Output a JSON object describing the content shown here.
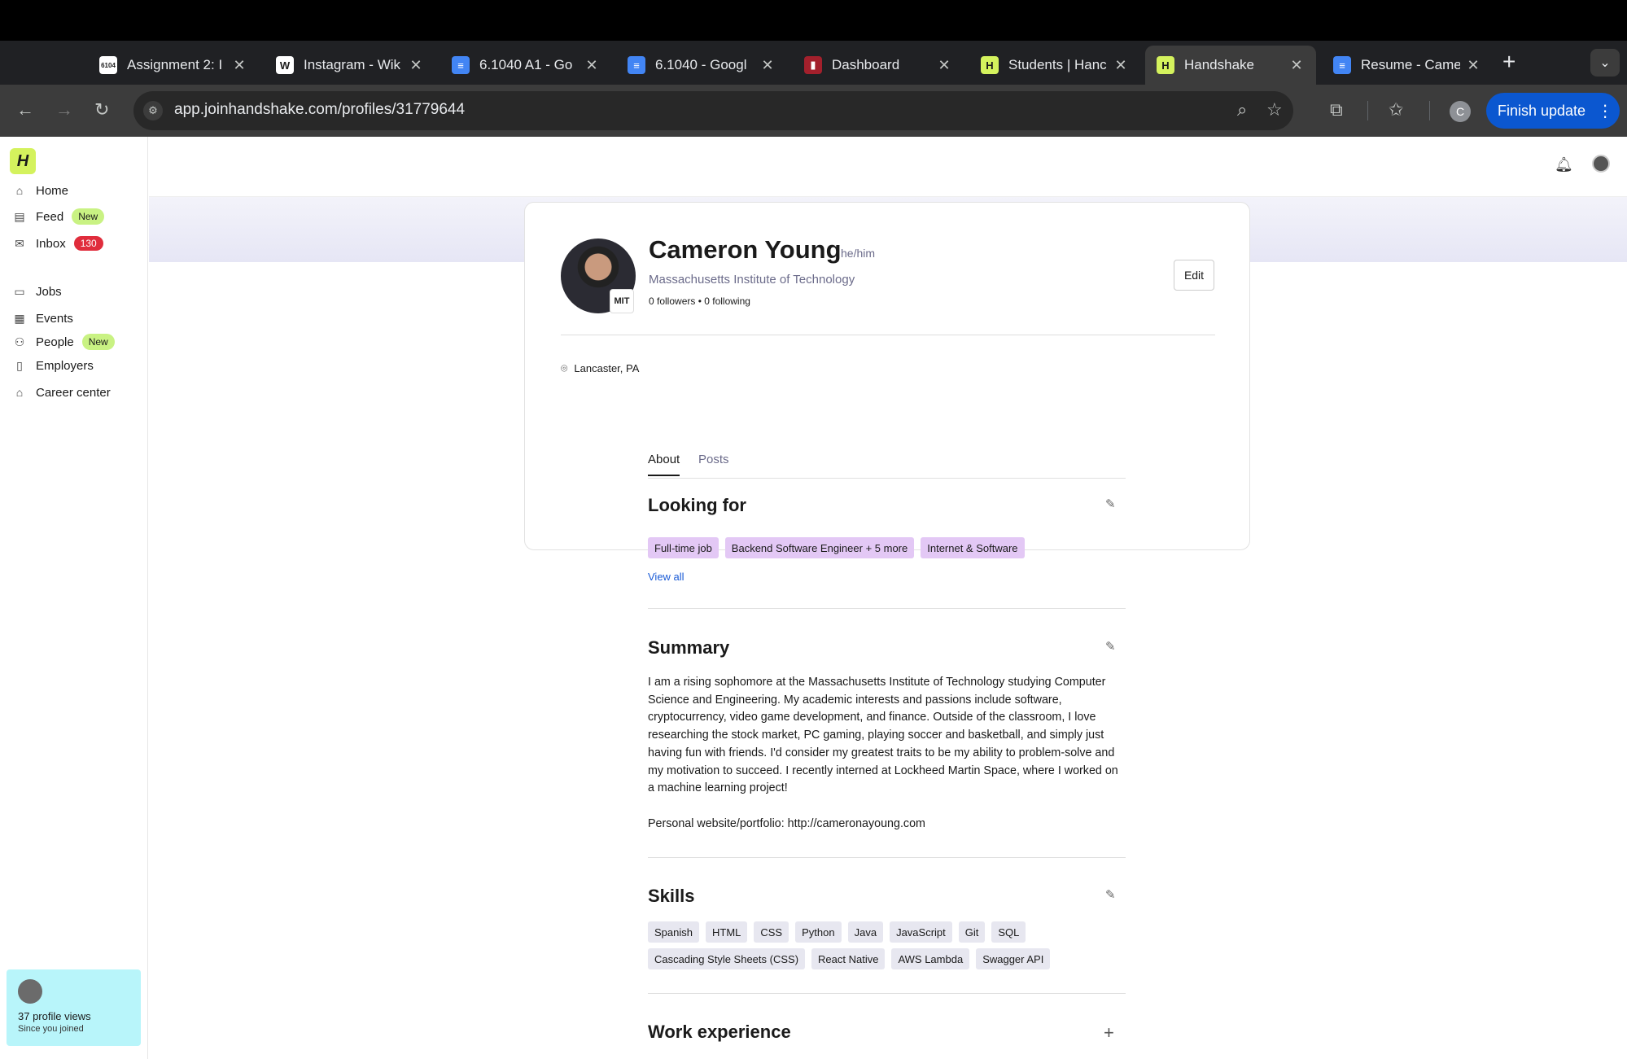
{
  "browser": {
    "tabs": [
      {
        "title": "Assignment 2: I",
        "favicon": "6104",
        "fav_bg": "#ffffff",
        "fav_color": "#1a1a1a"
      },
      {
        "title": "Instagram - Wik",
        "favicon": "W",
        "fav_bg": "#ffffff",
        "fav_color": "#1a1a1a"
      },
      {
        "title": "6.1040 A1 - Go",
        "favicon": "doc-icon",
        "fav_bg": "#4285f4",
        "fav_color": "#ffffff"
      },
      {
        "title": "6.1040 - Googl",
        "favicon": "doc-icon",
        "fav_bg": "#4285f4",
        "fav_color": "#ffffff"
      },
      {
        "title": "Dashboard",
        "favicon": "dashboard-icon",
        "fav_bg": "#a3202c",
        "fav_color": "#ffffff"
      },
      {
        "title": "Students | Hanc",
        "favicon": "H",
        "fav_bg": "#d4f25d",
        "fav_color": "#1a1a1a"
      },
      {
        "title": "Handshake",
        "favicon": "H",
        "fav_bg": "#d4f25d",
        "fav_color": "#1a1a1a",
        "active": true
      },
      {
        "title": "Resume - Came",
        "favicon": "doc-icon",
        "fav_bg": "#4285f4",
        "fav_color": "#ffffff"
      }
    ],
    "url": "app.joinhandshake.com/profiles/31779644",
    "profile_initial": "C",
    "finish_update": "Finish update"
  },
  "sidebar": {
    "logo": "H",
    "items": [
      {
        "label": "Home",
        "icon": "home-icon",
        "glyph": "⌂"
      },
      {
        "label": "Feed",
        "icon": "feed-icon",
        "glyph": "▤",
        "badge": "New"
      },
      {
        "label": "Inbox",
        "icon": "inbox-icon",
        "glyph": "✉",
        "count": "130"
      },
      {
        "label": "Jobs",
        "icon": "briefcase-icon",
        "glyph": "▭"
      },
      {
        "label": "Events",
        "icon": "calendar-icon",
        "glyph": "▦"
      },
      {
        "label": "People",
        "icon": "people-icon",
        "glyph": "⚇",
        "badge": "New"
      },
      {
        "label": "Employers",
        "icon": "building-icon",
        "glyph": "▯"
      },
      {
        "label": "Career center",
        "icon": "graduation-cap-icon",
        "glyph": "⌂"
      }
    ],
    "views_card": {
      "count_text": "37 profile views",
      "sub": "Since you joined"
    }
  },
  "profile": {
    "name": "Cameron Young",
    "pronouns": "he/him",
    "school": "Massachusetts Institute of Technology",
    "school_badge": "MIT",
    "followers_text": "0 followers • 0 following",
    "edit_label": "Edit",
    "location": "Lancaster, PA"
  },
  "tabs": [
    {
      "label": "About",
      "active": true
    },
    {
      "label": "Posts",
      "active": false
    }
  ],
  "looking_for": {
    "title": "Looking for",
    "chips": [
      "Full-time job",
      "Backend Software Engineer + 5 more",
      "Internet & Software"
    ],
    "view_all": "View all"
  },
  "summary": {
    "title": "Summary",
    "paragraphs": [
      "I am a rising sophomore at the Massachusetts Institute of Technology studying Computer Science and Engineering. My academic interests and passions include software, cryptocurrency, video game development, and finance. Outside of the classroom, I love researching the stock market, PC gaming, playing soccer and basketball, and simply just having fun with friends. I'd consider my greatest traits to be my ability to problem-solve and my motivation to succeed. I recently interned at Lockheed Martin Space, where I worked on a machine learning project!",
      "Personal website/portfolio: http://cameronayoung.com"
    ]
  },
  "skills": {
    "title": "Skills",
    "row1": [
      "Spanish",
      "HTML",
      "CSS",
      "Python",
      "Java",
      "JavaScript",
      "Git",
      "SQL"
    ],
    "row2": [
      "Cascading Style Sheets (CSS)",
      "React Native",
      "AWS Lambda",
      "Swagger API"
    ]
  },
  "work_experience": {
    "title": "Work experience"
  }
}
